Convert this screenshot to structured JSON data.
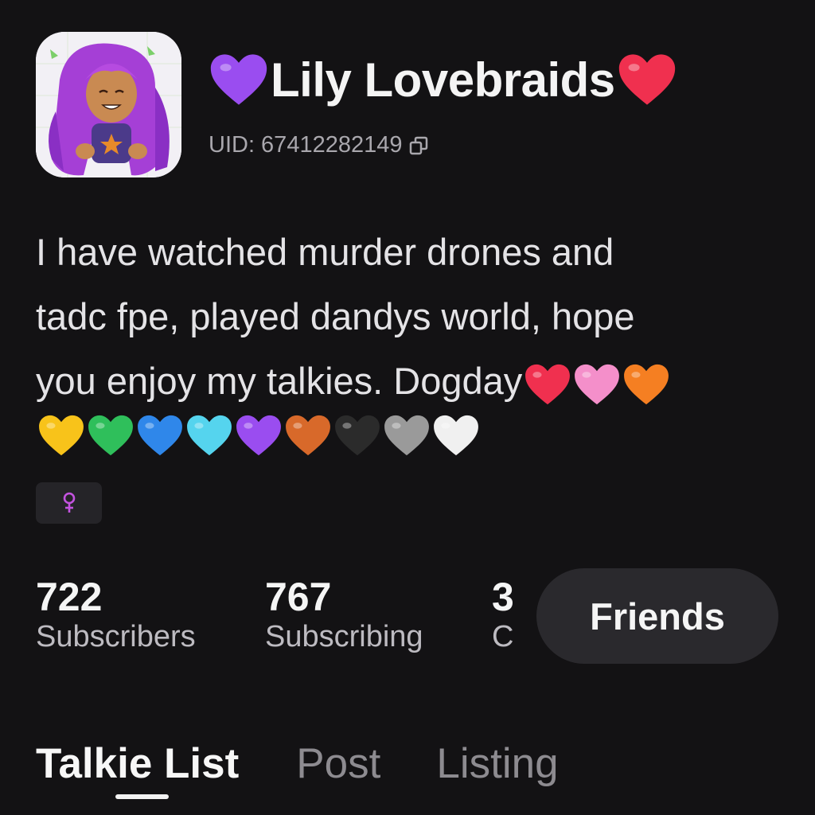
{
  "profile": {
    "name": "Lily Lovebraids",
    "uid_label": "UID: 67412282149",
    "avatar_icon": "character-avatar-purple-braids"
  },
  "bio": {
    "line1": "I have watched murder drones and",
    "line2": "tadc fpe, played dandys world, hope",
    "line3": "you enjoy my talkies. Dogday"
  },
  "gender": {
    "symbol": "♀",
    "color": "#c453e0"
  },
  "stats": [
    {
      "value": "722",
      "label": "Subscribers"
    },
    {
      "value": "767",
      "label": "Subscribing"
    },
    {
      "value": "3",
      "label": "C"
    }
  ],
  "actions": {
    "friends_label": "Friends"
  },
  "tabs": [
    {
      "label": "Talkie List",
      "active": true
    },
    {
      "label": "Post",
      "active": false
    },
    {
      "label": "Listing",
      "active": false
    }
  ],
  "heart_colors": {
    "purple": "#9a4df0",
    "red": "#f0304f",
    "pink": "#f48fca",
    "orange": "#f57f22",
    "yellow": "#f8c31a",
    "green": "#2fbf5b",
    "blue": "#2f87ea",
    "light_blue": "#55d4ee",
    "brown": "#d8692a",
    "black": "#2b2b2b",
    "grey": "#9a9a9a",
    "white": "#f0f0f0"
  }
}
